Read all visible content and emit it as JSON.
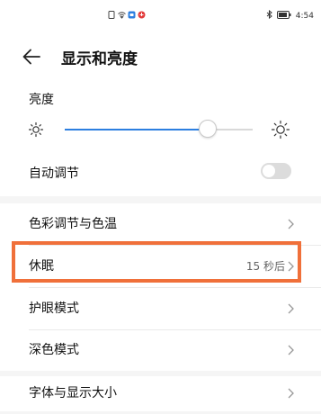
{
  "status_bar": {
    "icons": [
      "sim-icon",
      "wifi-icon",
      "app-icon",
      "huawei-icon"
    ],
    "right_icons": [
      "bluetooth-icon",
      "battery-icon"
    ],
    "time": "4:54"
  },
  "header": {
    "back_icon": "back-arrow-icon",
    "title": "显示和亮度"
  },
  "brightness": {
    "label": "亮度",
    "level": 0.76,
    "min_icon": "sun-small-icon",
    "max_icon": "sun-large-icon"
  },
  "auto_adjust": {
    "label": "自动调节",
    "enabled": false
  },
  "rows": [
    {
      "label": "色彩调节与色温",
      "value": ""
    },
    {
      "label": "休眠",
      "value": "15 秒后"
    },
    {
      "label": "护眼模式",
      "value": ""
    },
    {
      "label": "深色模式",
      "value": ""
    }
  ],
  "bottom_row": {
    "label": "字体与显示大小"
  },
  "colors": {
    "accent": "#2d7fe0",
    "highlight": "#f0703a"
  }
}
